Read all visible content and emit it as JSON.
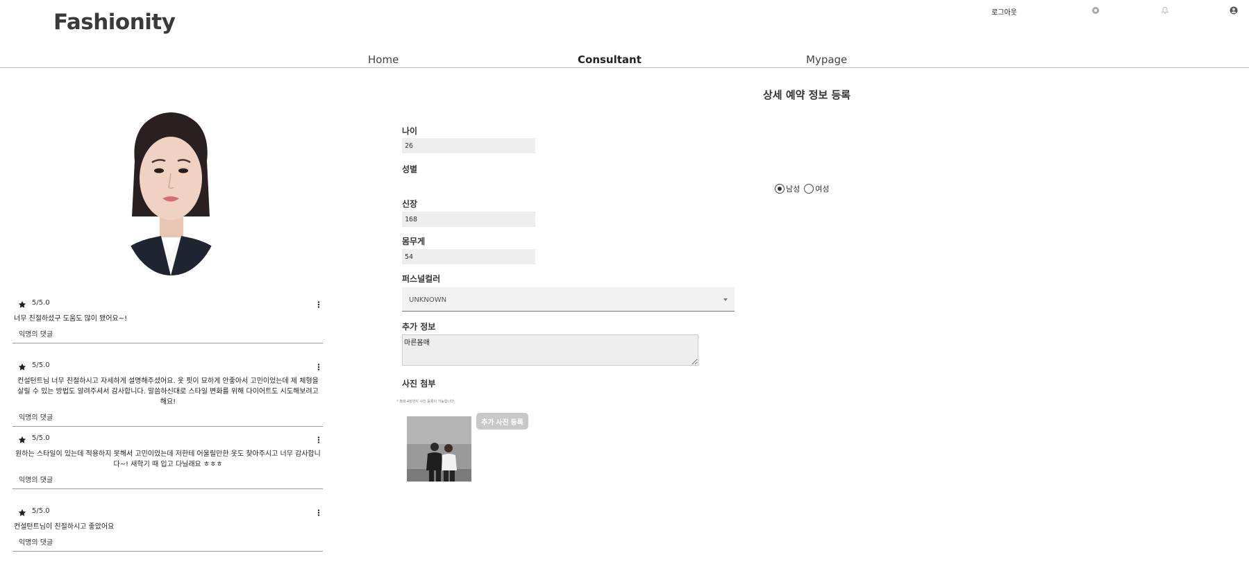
{
  "header": {
    "logo": "Fashionity",
    "logout": "로그아웃",
    "icons": [
      "settings-icon",
      "bell-icon",
      "user-icon"
    ]
  },
  "nav": {
    "items": [
      {
        "label": "Home"
      },
      {
        "label": "Consultant"
      },
      {
        "label": "Mypage"
      }
    ]
  },
  "page": {
    "title": "상세 예약 정보 등록"
  },
  "reviews": [
    {
      "score": "5/5.0",
      "text": "너무 친절하셨구 도움도 많이 됐어요~!",
      "comment": "익명의 댓글"
    },
    {
      "score": "5/5.0",
      "text": "컨설턴트님 너무 친절하시고 자세하게 설명해주셨어요. 옷 핏이 묘하게 안좋아서 고민이었는데 제 체형을 살릴 수 있는 방법도 알려주셔서 감사합니다. 말씀하신대로 스타일 변화를 위해 다이어트도 시도해보려고 해요!",
      "comment": "익명의 댓글"
    },
    {
      "score": "5/5.0",
      "text": "원하는 스타일이 있는데 적용하지 못해서 고민이었는데 저한테 어울릴만한 옷도 찾아주시고 너무 감사합니다~! 새학기 때 입고 다닐래요 ㅎㅎㅎ",
      "comment": "익명의 댓글"
    },
    {
      "score": "5/5.0",
      "text": "컨설턴트님이 친절하시고 좋았어요",
      "comment": "익명의 댓글"
    }
  ],
  "form": {
    "age": {
      "label": "나이",
      "value": "26"
    },
    "gender": {
      "label": "성별",
      "options": [
        "남성",
        "여성"
      ],
      "selected": "남성"
    },
    "height": {
      "label": "신장",
      "value": "168"
    },
    "weight": {
      "label": "몸무게",
      "value": "54"
    },
    "personal_color": {
      "label": "퍼스널컬러",
      "value": "UNKNOWN"
    },
    "extra": {
      "label": "추가 정보",
      "value": "마른몸매"
    },
    "photo": {
      "label": "사진 첨부",
      "note": "* 최대 4장까지 사진 등록이 가능합니다.",
      "add_button": "추가 사진 등록"
    }
  },
  "colors": {
    "accent": "#333333",
    "input_bg": "#eeeeee",
    "button_disabled": "#c8c8c8"
  }
}
